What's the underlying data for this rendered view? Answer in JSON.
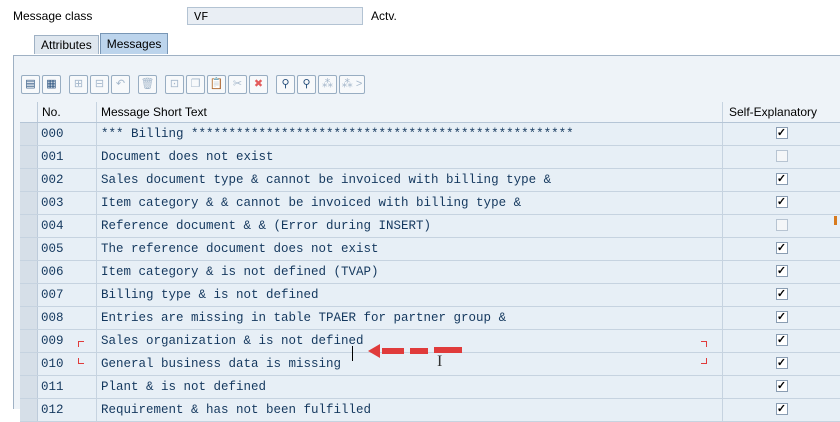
{
  "header": {
    "message_class_label": "Message class",
    "message_class_value": "VF",
    "status": "Actv."
  },
  "tabs": [
    {
      "label": "Attributes",
      "active": false
    },
    {
      "label": "Messages",
      "active": true
    }
  ],
  "toolbar": {
    "buttons": [
      {
        "icon": "detail-view-icon"
      },
      {
        "icon": "object-list-icon"
      },
      {
        "icon": "insert-row-icon"
      },
      {
        "icon": "append-row-icon"
      },
      {
        "icon": "undo-icon"
      },
      {
        "icon": "delete-icon"
      },
      {
        "icon": "select-all-icon"
      },
      {
        "icon": "copy-icon"
      },
      {
        "icon": "paste-icon"
      },
      {
        "icon": "cut-icon"
      },
      {
        "icon": "delete-rows-icon"
      },
      {
        "icon": "find-icon"
      },
      {
        "icon": "find-next-icon"
      },
      {
        "icon": "previous-page-icon"
      },
      {
        "icon": "next-page-icon"
      }
    ],
    "next_label": ">"
  },
  "table": {
    "columns": [
      "No.",
      "Message Short Text",
      "Self-Explanatory"
    ],
    "rows": [
      {
        "no": "000",
        "text": "*** Billing ***************************************************",
        "self_explanatory": true
      },
      {
        "no": "001",
        "text": "Document does not exist",
        "self_explanatory": false
      },
      {
        "no": "002",
        "text": "Sales document type & cannot be invoiced with billing type &",
        "self_explanatory": true
      },
      {
        "no": "003",
        "text": "Item category & & cannot be invoiced with billing type &",
        "self_explanatory": true
      },
      {
        "no": "004",
        "text": "Reference document & & (Error during INSERT)",
        "self_explanatory": false
      },
      {
        "no": "005",
        "text": "The reference document does not exist",
        "self_explanatory": true
      },
      {
        "no": "006",
        "text": "Item category & is not defined (TVAP)",
        "self_explanatory": true
      },
      {
        "no": "007",
        "text": "Billing type & is not defined",
        "self_explanatory": true
      },
      {
        "no": "008",
        "text": "Entries are missing in table TPAER for partner group &",
        "self_explanatory": true
      },
      {
        "no": "009",
        "text": "Sales organization & is not defined",
        "self_explanatory": true
      },
      {
        "no": "010",
        "text": "General business data is missing",
        "self_explanatory": true
      },
      {
        "no": "011",
        "text": "Plant & is not defined",
        "self_explanatory": true
      },
      {
        "no": "012",
        "text": "Requirement & has not been fulfilled",
        "self_explanatory": true
      }
    ]
  },
  "annotation": {
    "arrow_color": "#e03b3b"
  },
  "colors": {
    "accent": "#bcd4ec",
    "row_bg": "#e7eff6",
    "text": "#14385e"
  }
}
